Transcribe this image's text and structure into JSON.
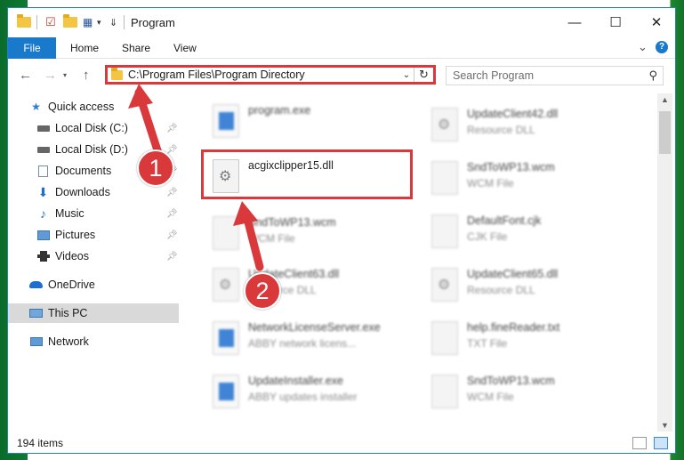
{
  "window": {
    "title": "Program",
    "minimize": "—",
    "maximize": "☐",
    "close": "✕"
  },
  "ribbon": {
    "tabs": [
      "File",
      "Home",
      "Share",
      "View"
    ],
    "expand": "⌄",
    "help": "?"
  },
  "address": {
    "path": "C:\\Program Files\\Program Directory",
    "refresh": "↻",
    "dropdown": "⌄"
  },
  "search": {
    "placeholder": "Search Program"
  },
  "nav_pane": {
    "items": [
      {
        "label": "Quick access",
        "icon": "star-icon"
      },
      {
        "label": "Local Disk (C:)",
        "icon": "drive-icon",
        "pinned": true
      },
      {
        "label": "Local Disk (D:)",
        "icon": "drive-icon",
        "pinned": true
      },
      {
        "label": "Documents",
        "icon": "documents-icon",
        "pinned": true
      },
      {
        "label": "Downloads",
        "icon": "download-icon",
        "pinned": true
      },
      {
        "label": "Music",
        "icon": "music-icon",
        "pinned": true
      },
      {
        "label": "Pictures",
        "icon": "pictures-icon",
        "pinned": true
      },
      {
        "label": "Videos",
        "icon": "videos-icon",
        "pinned": true
      },
      {
        "label": "OneDrive",
        "icon": "cloud-icon"
      },
      {
        "label": "This PC",
        "icon": "computer-icon",
        "selected": true
      },
      {
        "label": "Network",
        "icon": "network-icon"
      }
    ]
  },
  "files": [
    {
      "name": "program.exe",
      "type": ""
    },
    {
      "name": "acgixclipper15.dll",
      "type": ""
    },
    {
      "name": "SndToWP13.wcm",
      "type": "WCM File"
    },
    {
      "name": "UpdateClient63.dll",
      "type": "Resource DLL"
    },
    {
      "name": "NetworkLicenseServer.exe",
      "type": "ABBY network licens..."
    },
    {
      "name": "UpdateInstaller.exe",
      "type": "ABBY updates installer"
    },
    {
      "name": "UpdateClient42.dll",
      "type": "Resource DLL"
    },
    {
      "name": "SndToWP13.wcm",
      "type": "WCM File"
    },
    {
      "name": "DefaultFont.cjk",
      "type": "CJK File"
    },
    {
      "name": "UpdateClient65.dll",
      "type": "Resource DLL"
    },
    {
      "name": "help.fineReader.txt",
      "type": "TXT File"
    },
    {
      "name": "SndToWP13.wcm",
      "type": "WCM File"
    }
  ],
  "status": {
    "items_count": "194 items"
  },
  "annotations": {
    "step1": "1",
    "step2": "2"
  },
  "colors": {
    "accent": "#1979ca",
    "highlight": "#d9393a"
  }
}
